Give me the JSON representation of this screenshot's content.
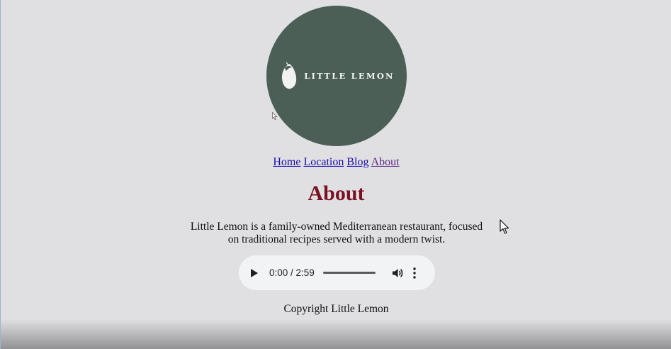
{
  "logo": {
    "text": "LITTLE LEMON",
    "icon": "lemon-icon",
    "background": "#4b5f57"
  },
  "nav": {
    "items": [
      {
        "label": "Home",
        "state": "link"
      },
      {
        "label": "Location",
        "state": "link"
      },
      {
        "label": "Blog",
        "state": "link"
      },
      {
        "label": "About",
        "state": "visited"
      }
    ]
  },
  "main": {
    "heading": "About",
    "heading_color": "#7a1022",
    "description": "Little Lemon is a family-owned Mediterranean restaurant, focused on traditional recipes served with a modern twist."
  },
  "audio_player": {
    "time": "0:00 / 2:59",
    "progress": 0,
    "play_icon": "play-icon",
    "volume_icon": "volume-icon",
    "menu_icon": "more-vert-icon"
  },
  "footer": {
    "copyright": "Copyright Little Lemon"
  }
}
